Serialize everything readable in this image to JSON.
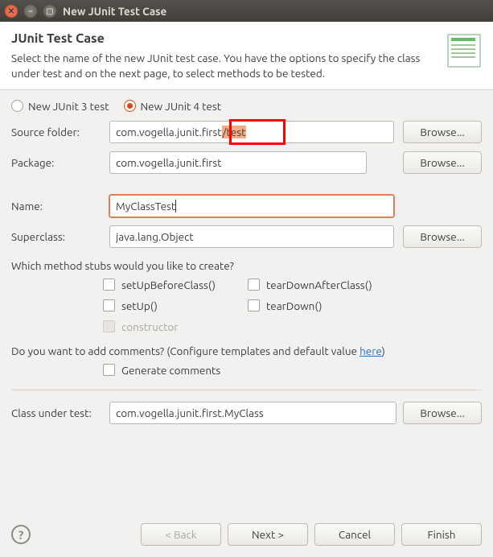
{
  "window": {
    "title": "New JUnit Test Case"
  },
  "header": {
    "title": "JUnit Test Case",
    "description": "Select the name of the new JUnit test case. You have the options to specify the class under test and on the next page, to select methods to be tested."
  },
  "radios": {
    "junit3": "New JUnit 3 test",
    "junit4": "New JUnit 4 test",
    "selected": "junit4"
  },
  "form": {
    "source_folder_label": "Source folder:",
    "source_folder_prefix": "com.vogella.junit.first",
    "source_folder_selected": "/test",
    "package_label": "Package:",
    "package_value": "com.vogella.junit.first",
    "name_label": "Name:",
    "name_value": "MyClassTest",
    "superclass_label": "Superclass:",
    "superclass_value": "java.lang.Object",
    "browse_label": "Browse..."
  },
  "stubs": {
    "question": "Which method stubs would you like to create?",
    "setUpBeforeClass": "setUpBeforeClass()",
    "tearDownAfterClass": "tearDownAfterClass()",
    "setUp": "setUp()",
    "tearDown": "tearDown()",
    "constructor": "constructor"
  },
  "comments": {
    "question_prefix": "Do you want to add comments? (Configure templates and default value ",
    "link": "here",
    "question_suffix": ")",
    "generate": "Generate comments"
  },
  "class_under_test": {
    "label": "Class under test:",
    "value": "com.vogella.junit.first.MyClass"
  },
  "buttons": {
    "back": "< Back",
    "next": "Next >",
    "cancel": "Cancel",
    "finish": "Finish"
  }
}
